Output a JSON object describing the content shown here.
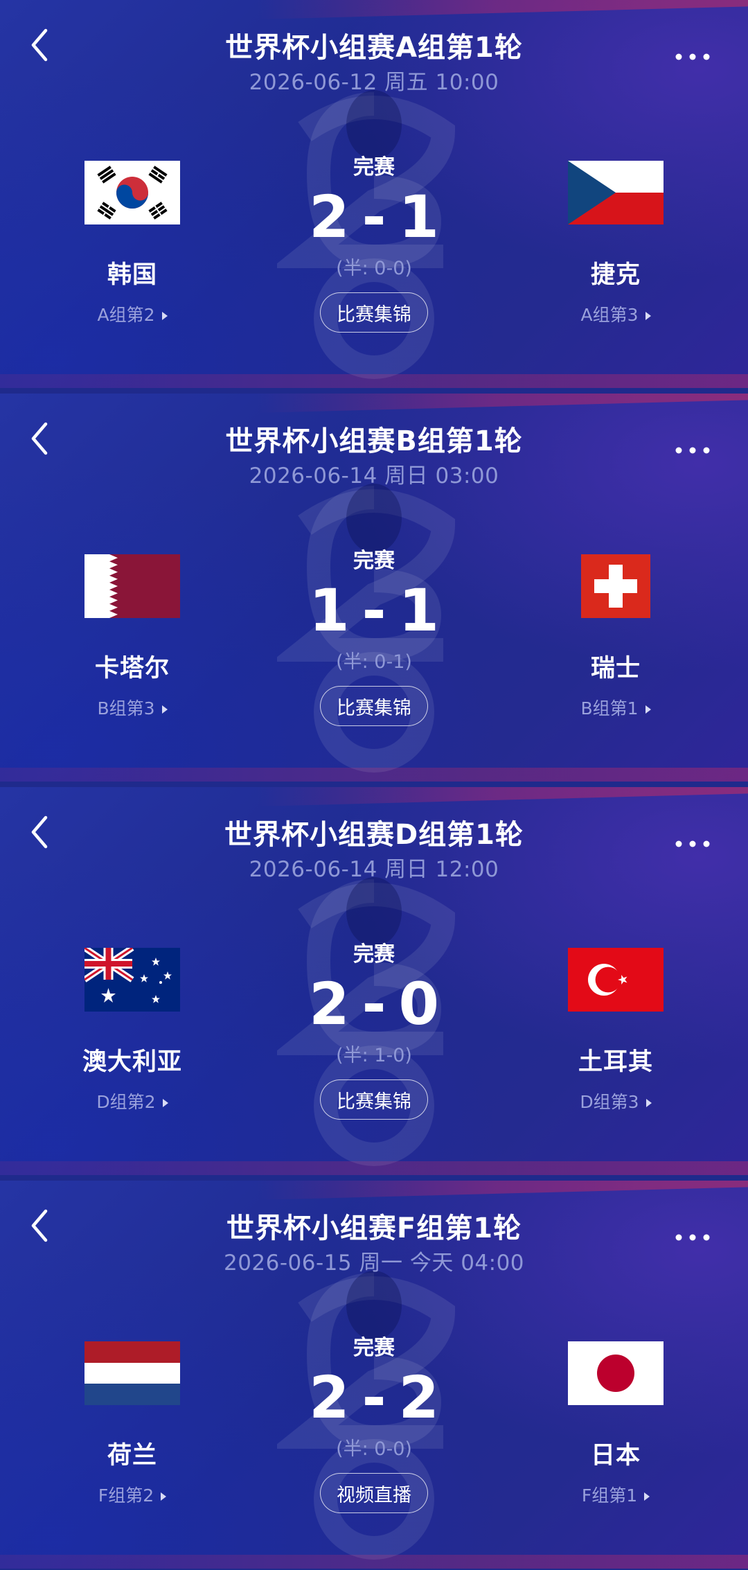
{
  "matches": [
    {
      "title": "世界杯小组赛A组第1轮",
      "datetime": "2026-06-12 周五 10:00",
      "status": "完赛",
      "home": {
        "name": "韩国",
        "group_rank": "A组第2",
        "flag": "south-korea-flag"
      },
      "away": {
        "name": "捷克",
        "group_rank": "A组第3",
        "flag": "czech-flag"
      },
      "home_score": "2",
      "away_score": "1",
      "halftime": "(半: 0-0)",
      "button_label": "比赛集锦"
    },
    {
      "title": "世界杯小组赛B组第1轮",
      "datetime": "2026-06-14 周日 03:00",
      "status": "完赛",
      "home": {
        "name": "卡塔尔",
        "group_rank": "B组第3",
        "flag": "qatar-flag"
      },
      "away": {
        "name": "瑞士",
        "group_rank": "B组第1",
        "flag": "switzerland-flag"
      },
      "home_score": "1",
      "away_score": "1",
      "halftime": "(半: 0-1)",
      "button_label": "比赛集锦"
    },
    {
      "title": "世界杯小组赛D组第1轮",
      "datetime": "2026-06-14 周日 12:00",
      "status": "完赛",
      "home": {
        "name": "澳大利亚",
        "group_rank": "D组第2",
        "flag": "australia-flag"
      },
      "away": {
        "name": "土耳其",
        "group_rank": "D组第3",
        "flag": "turkey-flag"
      },
      "home_score": "2",
      "away_score": "0",
      "halftime": "(半: 1-0)",
      "button_label": "比赛集锦"
    },
    {
      "title": "世界杯小组赛F组第1轮",
      "datetime": "2026-06-15 周一 今天 04:00",
      "status": "完赛",
      "home": {
        "name": "荷兰",
        "group_rank": "F组第2",
        "flag": "netherlands-flag"
      },
      "away": {
        "name": "日本",
        "group_rank": "F组第1",
        "flag": "japan-flag"
      },
      "home_score": "2",
      "away_score": "2",
      "halftime": "(半: 0-0)",
      "button_label": "视频直播"
    }
  ],
  "icons": {
    "back": "chevron-left-icon",
    "more": "more-dots-icon",
    "rank_arrow": "triangle-right-icon"
  },
  "colors": {
    "background": "#1f2a8c",
    "secondary_text": "#8f98d6",
    "accent_stripe": "#a22d73"
  }
}
